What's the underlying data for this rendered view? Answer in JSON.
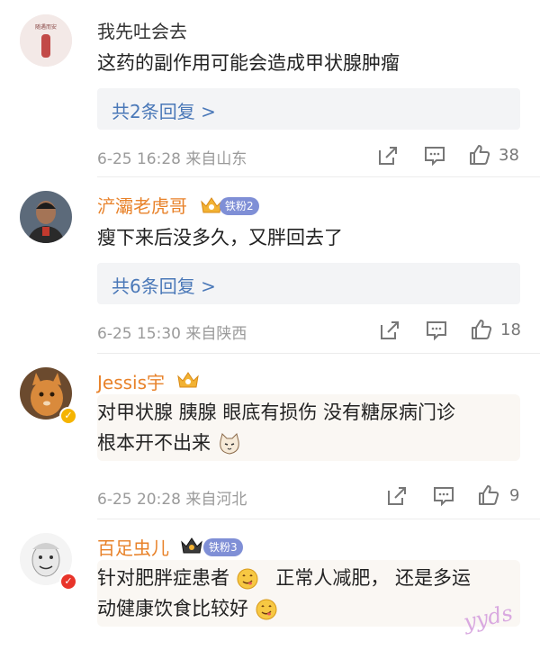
{
  "comments": [
    {
      "username": "我先吐会去",
      "text": [
        "这药的副作用可能会造成甲状腺肿瘤"
      ],
      "replies": "共2条回复 >",
      "meta": "6-25 16:28 来自山东",
      "likes": "38",
      "avatar_text": "随遇而安"
    },
    {
      "username": "浐灞老虎哥",
      "badge": "铁粉2",
      "text": [
        "瘦下来后没多久，又胖回去了"
      ],
      "replies": "共6条回复 >",
      "meta": "6-25 15:30 来自陕西",
      "likes": "18"
    },
    {
      "username": "Jessis宇",
      "text": [
        "对甲状腺 胰腺 眼底有损伤 没有糖尿病门诊",
        "根本开不出来"
      ],
      "meta": "6-25 20:28 来自河北",
      "likes": "9"
    },
    {
      "username": "百足虫儿",
      "badge": "铁粉3",
      "text": [
        "针对肥胖症患者",
        "正常人减肥， 还是多运",
        "动健康饮食比较好"
      ]
    }
  ],
  "watermark": "yyds",
  "colors": {
    "link": "#4a78b8",
    "vip_name": "#e8822a",
    "meta": "#9a9a9a",
    "badge": "#7f8fd6"
  }
}
